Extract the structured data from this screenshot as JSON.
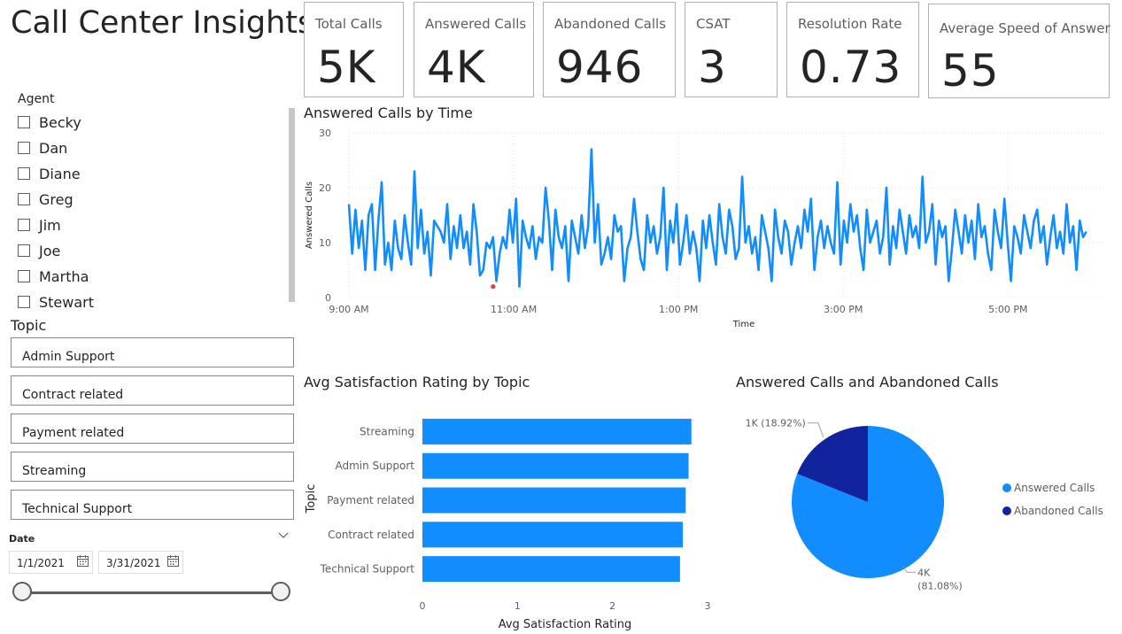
{
  "page": {
    "title": "Call Center Insights"
  },
  "kpis": [
    {
      "label": "Total Calls",
      "value": "5K"
    },
    {
      "label": "Answered Calls",
      "value": "4K"
    },
    {
      "label": "Abandoned Calls",
      "value": "946"
    },
    {
      "label": "CSAT",
      "value": "3"
    },
    {
      "label": "Resolution Rate",
      "value": "0.73"
    },
    {
      "label": "Average Speed of Answer",
      "value": "55"
    }
  ],
  "agent_slicer": {
    "title": "Agent",
    "items": [
      "Becky",
      "Dan",
      "Diane",
      "Greg",
      "Jim",
      "Joe",
      "Martha",
      "Stewart"
    ]
  },
  "topic_slicer": {
    "title": "Topic",
    "items": [
      "Admin Support",
      "Contract related",
      "Payment related",
      "Streaming",
      "Technical Support"
    ]
  },
  "date_slicer": {
    "label": "Date",
    "start": "1/1/2021",
    "end": "3/31/2021"
  },
  "colors": {
    "series_blue": "#118dff",
    "series_dark": "#12239e",
    "marker_red": "#d64550"
  },
  "chart_data": [
    {
      "type": "line",
      "title": "Answered Calls by Time",
      "xlabel": "Time",
      "ylabel": "Answered Calls",
      "xticks": [
        "9:00 AM",
        "11:00 AM",
        "1:00 PM",
        "3:00 PM",
        "5:00 PM"
      ],
      "x_range_hours": [
        9,
        18.2
      ],
      "ylim": [
        0,
        30
      ],
      "yticks": [
        0,
        10,
        20,
        30
      ],
      "grid": true,
      "values": [
        17,
        8,
        16,
        9,
        14,
        5,
        15,
        17,
        5,
        14,
        21,
        6,
        10,
        5,
        14,
        9,
        7,
        15,
        10,
        6,
        23,
        9,
        16,
        8,
        12,
        4,
        14,
        13,
        12,
        10,
        17,
        7,
        13,
        9,
        15,
        9,
        12,
        6,
        17,
        12,
        4,
        5,
        10,
        9,
        11,
        3,
        8,
        11,
        9,
        16,
        10,
        18,
        2,
        14,
        11,
        9,
        13,
        7,
        11,
        10,
        20,
        14,
        5,
        16,
        11,
        9,
        13,
        3,
        14,
        11,
        8,
        15,
        9,
        13,
        27,
        10,
        17,
        6,
        8,
        11,
        7,
        15,
        12,
        13,
        3,
        9,
        11,
        18,
        12,
        7,
        5,
        15,
        10,
        13,
        8,
        11,
        20,
        5,
        14,
        10,
        17,
        6,
        10,
        15,
        8,
        12,
        9,
        3,
        14,
        9,
        15,
        10,
        6,
        17,
        11,
        8,
        16,
        13,
        7,
        9,
        22,
        10,
        13,
        8,
        11,
        5,
        15,
        12,
        9,
        3,
        16,
        11,
        8,
        14,
        12,
        6,
        10,
        13,
        9,
        16,
        12,
        18,
        5,
        11,
        14,
        9,
        13,
        10,
        8,
        21,
        6,
        14,
        10,
        17,
        12,
        15,
        9,
        5,
        16,
        10,
        12,
        14,
        8,
        11,
        20,
        6,
        13,
        9,
        16,
        12,
        8,
        15,
        11,
        13,
        9,
        22,
        10,
        12,
        17,
        6,
        14,
        11,
        13,
        3,
        9,
        16,
        12,
        8,
        15,
        10,
        14,
        7,
        17,
        11,
        13,
        8,
        5,
        16,
        12,
        9,
        18,
        10,
        3,
        13,
        11,
        8,
        15,
        12,
        9,
        14,
        16,
        10,
        13,
        6,
        11,
        15,
        9,
        12,
        8,
        17,
        10,
        13,
        5,
        14,
        11,
        12
      ],
      "highlight_point": {
        "x_hours": 10.75,
        "value": 2
      }
    },
    {
      "type": "bar",
      "orientation": "horizontal",
      "title": "Avg Satisfaction Rating by Topic",
      "xlabel": "Avg Satisfaction Rating",
      "ylabel": "Topic",
      "categories": [
        "Streaming",
        "Admin Support",
        "Payment related",
        "Contract related",
        "Technical Support"
      ],
      "values": [
        2.83,
        2.8,
        2.77,
        2.74,
        2.71
      ],
      "xlim": [
        0,
        3
      ],
      "xticks": [
        0,
        1,
        2,
        3
      ]
    },
    {
      "type": "pie",
      "title": "Answered Calls and Abandoned Calls",
      "slices": [
        {
          "name": "Answered Calls",
          "value": 81.08,
          "label": "4K",
          "pct_label": "(81.08%)"
        },
        {
          "name": "Abandoned Calls",
          "value": 18.92,
          "label": "1K (18.92%)"
        }
      ],
      "legend": "right"
    }
  ]
}
